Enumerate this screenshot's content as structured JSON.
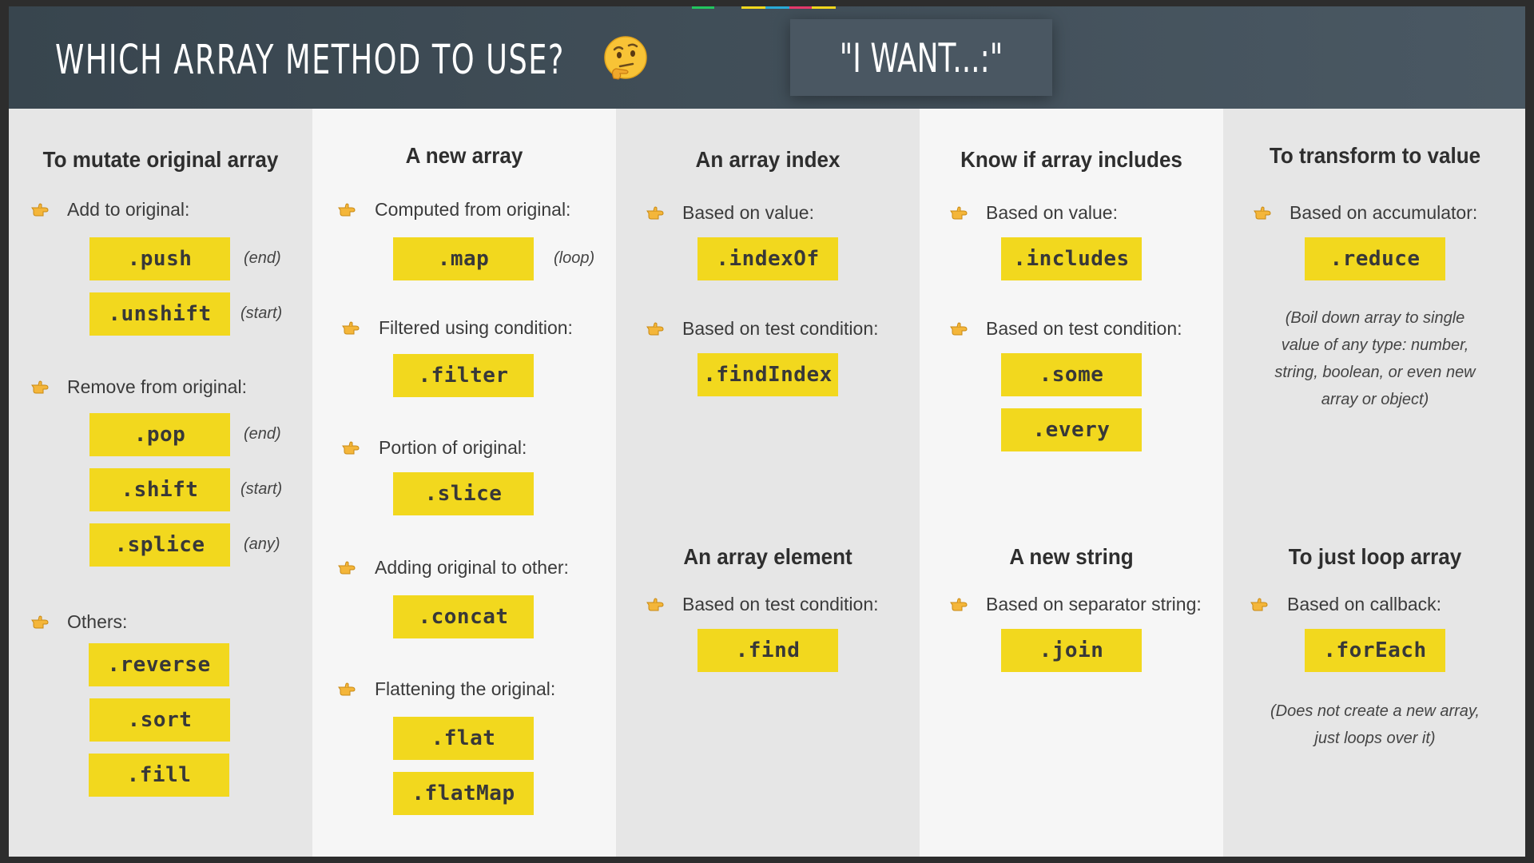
{
  "header": {
    "title": "Which array method to use?",
    "want": "\"I WANT...:\"",
    "emoji_icon": "thinking-face-icon",
    "colors": {
      "bg": "#3e4b55",
      "chip": "#f2d81e",
      "accent": [
        "#22c55e",
        "#f2d81e",
        "#2aa9d6",
        "#e53a6b",
        "#f2d81e"
      ]
    }
  },
  "columns": [
    {
      "heading": "To mutate original array",
      "groups": [
        {
          "label": "Add to original:",
          "methods": [
            {
              "name": ".push",
              "note": "(end)"
            },
            {
              "name": ".unshift",
              "note": "(start)"
            }
          ]
        },
        {
          "label": "Remove from original:",
          "methods": [
            {
              "name": ".pop",
              "note": "(end)"
            },
            {
              "name": ".shift",
              "note": "(start)"
            },
            {
              "name": ".splice",
              "note": "(any)"
            }
          ]
        },
        {
          "label": "Others:",
          "methods": [
            {
              "name": ".reverse"
            },
            {
              "name": ".sort"
            },
            {
              "name": ".fill"
            }
          ]
        }
      ]
    },
    {
      "heading": "A new array",
      "groups": [
        {
          "label": "Computed from original:",
          "methods": [
            {
              "name": ".map",
              "note": "(loop)"
            }
          ]
        },
        {
          "label": "Filtered using condition:",
          "methods": [
            {
              "name": ".filter"
            }
          ]
        },
        {
          "label": "Portion of original:",
          "methods": [
            {
              "name": ".slice"
            }
          ]
        },
        {
          "label": "Adding original to other:",
          "methods": [
            {
              "name": ".concat"
            }
          ]
        },
        {
          "label": "Flattening the original:",
          "methods": [
            {
              "name": ".flat"
            },
            {
              "name": ".flatMap"
            }
          ]
        }
      ]
    },
    {
      "heading": "An array index",
      "groups": [
        {
          "label": "Based on value:",
          "methods": [
            {
              "name": ".indexOf"
            }
          ]
        },
        {
          "label": "Based on test condition:",
          "methods": [
            {
              "name": ".findIndex"
            }
          ]
        }
      ],
      "heading2": "An array element",
      "groups2": [
        {
          "label": "Based on test condition:",
          "methods": [
            {
              "name": ".find"
            }
          ]
        }
      ]
    },
    {
      "heading": "Know if array includes",
      "groups": [
        {
          "label": "Based on value:",
          "methods": [
            {
              "name": ".includes"
            }
          ]
        },
        {
          "label": "Based on test condition:",
          "methods": [
            {
              "name": ".some"
            },
            {
              "name": ".every"
            }
          ]
        }
      ],
      "heading2": "A new string",
      "groups2": [
        {
          "label": "Based on separator string:",
          "methods": [
            {
              "name": ".join"
            }
          ]
        }
      ]
    },
    {
      "heading": "To transform to value",
      "groups": [
        {
          "label": "Based on accumulator:",
          "methods": [
            {
              "name": ".reduce"
            }
          ]
        }
      ],
      "note": [
        "(Boil down array to single",
        "value of any type: number,",
        "string, boolean, or even new",
        "array or object)"
      ],
      "heading2": "To just loop array",
      "groups2": [
        {
          "label": "Based on callback:",
          "methods": [
            {
              "name": ".forEach"
            }
          ]
        }
      ],
      "note2": [
        "(Does not create a new array,",
        "just loops over it)"
      ]
    }
  ]
}
